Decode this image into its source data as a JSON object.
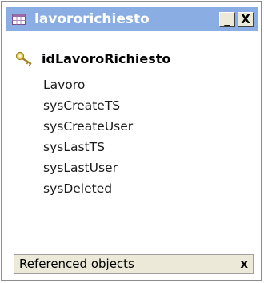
{
  "window": {
    "title": "lavororichiesto",
    "title_icon": "table-icon",
    "minimize_label": "_",
    "close_label": "X"
  },
  "primary_key": {
    "icon": "key-icon",
    "label": "idLavoroRichiesto"
  },
  "fields": [
    "Lavoro",
    "sysCreateTS",
    "sysCreateUser",
    "sysLastTS",
    "sysLastUser",
    "sysDeleted"
  ],
  "footer": {
    "label": "Referenced objects",
    "close_label": "x"
  },
  "colors": {
    "titlebar": "#8aaee3",
    "title_text": "#ffffff",
    "button_face": "#ece9d8",
    "key_icon": "#e0c040"
  }
}
